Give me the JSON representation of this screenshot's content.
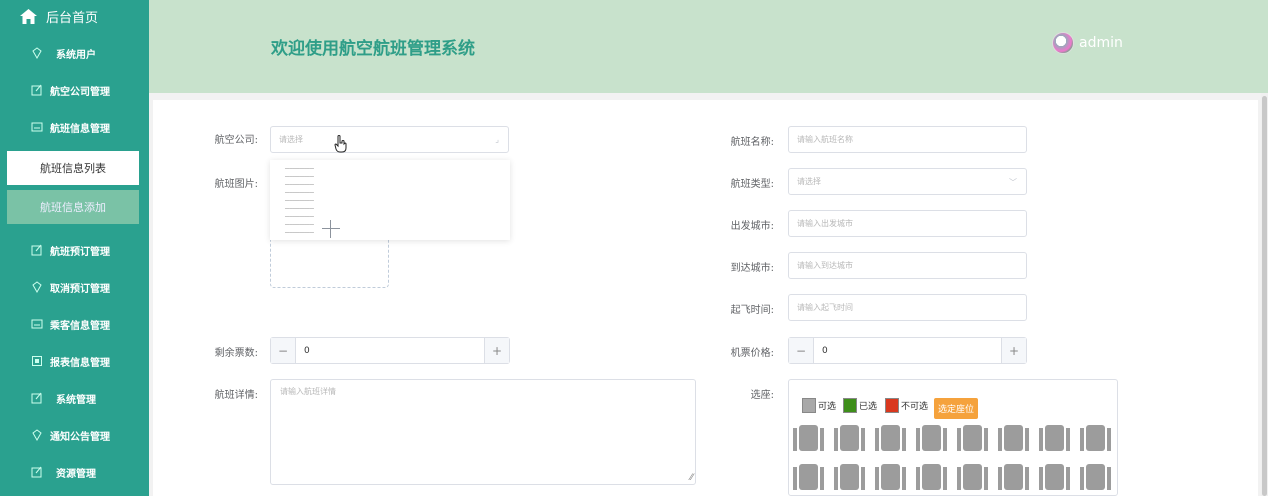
{
  "sidebar": {
    "home": "后台首页",
    "items": [
      {
        "label": "系统用户",
        "icon": "diamond-icon"
      },
      {
        "label": "航空公司管理",
        "icon": "edit-icon"
      },
      {
        "label": "航班信息管理",
        "icon": "card-icon"
      },
      {
        "label": "航班预订管理",
        "icon": "edit-icon"
      },
      {
        "label": "取消预订管理",
        "icon": "diamond-icon"
      },
      {
        "label": "乘客信息管理",
        "icon": "card-icon"
      },
      {
        "label": "报表信息管理",
        "icon": "report-icon"
      },
      {
        "label": "系统管理",
        "icon": "edit-icon"
      },
      {
        "label": "通知公告管理",
        "icon": "diamond-icon"
      },
      {
        "label": "资源管理",
        "icon": "edit-icon"
      }
    ],
    "sub": {
      "list": "航班信息列表",
      "add": "航班信息添加"
    }
  },
  "header": {
    "title": "欢迎使用航空航班管理系统",
    "user": "admin"
  },
  "form": {
    "airline": {
      "label": "航空公司:",
      "placeholder": "请选择"
    },
    "flight_name": {
      "label": "航班名称:",
      "placeholder": "请输入航班名称"
    },
    "image": {
      "label": "航班图片:"
    },
    "flight_type": {
      "label": "航班类型:",
      "placeholder": "请选择"
    },
    "departure": {
      "label": "出发城市:",
      "placeholder": "请输入出发城市"
    },
    "arrival": {
      "label": "到达城市:",
      "placeholder": "请输入到达城市"
    },
    "takeoff": {
      "label": "起飞时间:",
      "placeholder": "请输入起飞时间"
    },
    "remaining": {
      "label": "剩余票数:",
      "value": "0"
    },
    "price": {
      "label": "机票价格:",
      "value": "0"
    },
    "details": {
      "label": "航班详情:",
      "placeholder": "请输入航班详情"
    },
    "seat": {
      "label": "选座:",
      "legend": {
        "available": "可选",
        "selected": "已选",
        "unavailable": "不可选",
        "button": "选定座位"
      }
    }
  },
  "colors": {
    "sidebar": "#2aa18f",
    "header": "#c8e2cc",
    "title": "#2f9e88",
    "selected": "#3e8e1a",
    "unavailable": "#d9381e",
    "button": "#f5a23c"
  }
}
